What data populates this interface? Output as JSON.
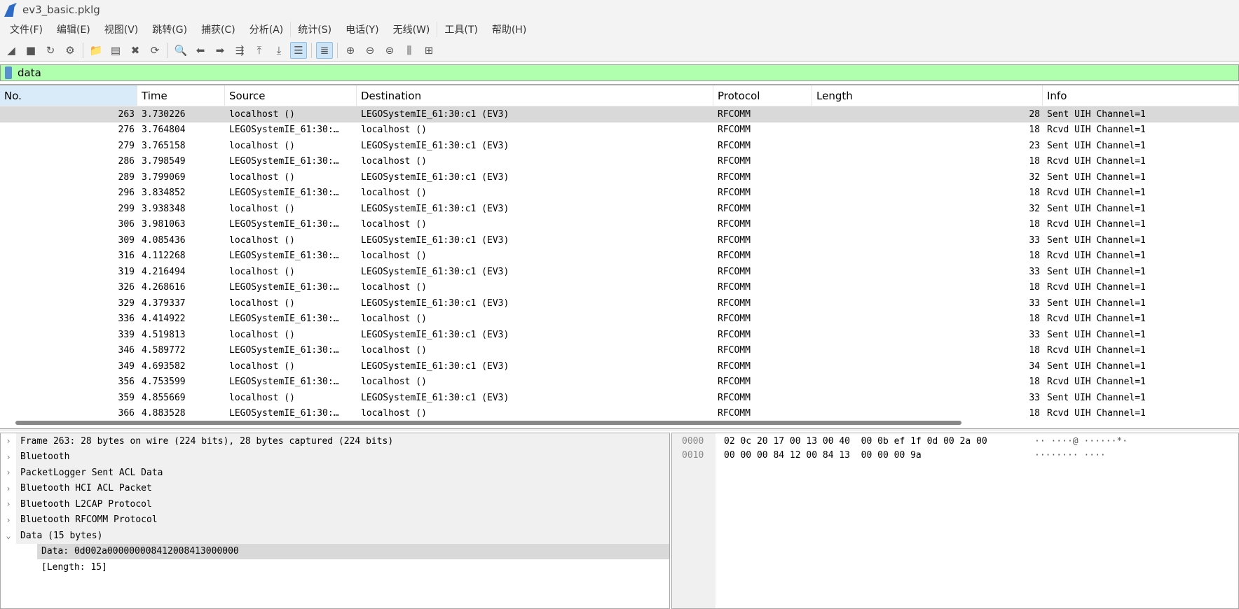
{
  "window": {
    "title": "ev3_basic.pklg"
  },
  "menu": [
    "文件(F)",
    "编辑(E)",
    "视图(V)",
    "跳转(G)",
    "捕获(C)",
    "分析(A)",
    "统计(S)",
    "电话(Y)",
    "无线(W)",
    "工具(T)",
    "帮助(H)"
  ],
  "toolbar": [
    {
      "icon": "shark-fin-start-icon",
      "glyph": "◢"
    },
    {
      "icon": "stop-icon",
      "glyph": "■"
    },
    {
      "icon": "restart-icon",
      "glyph": "↻"
    },
    {
      "icon": "capture-options-icon",
      "glyph": "⚙"
    },
    {
      "icon": "open-folder-icon",
      "glyph": "📁"
    },
    {
      "icon": "save-file-icon",
      "glyph": "▤"
    },
    {
      "icon": "close-file-icon",
      "glyph": "✖"
    },
    {
      "icon": "reload-icon",
      "glyph": "⟳"
    },
    {
      "icon": "find-icon",
      "glyph": "🔍"
    },
    {
      "icon": "go-back-icon",
      "glyph": "⬅"
    },
    {
      "icon": "go-forward-icon",
      "glyph": "➡"
    },
    {
      "icon": "go-to-packet-icon",
      "glyph": "⇶"
    },
    {
      "icon": "first-packet-icon",
      "glyph": "⤒"
    },
    {
      "icon": "last-packet-icon",
      "glyph": "⤓"
    },
    {
      "icon": "autoscroll-icon",
      "glyph": "☰"
    },
    {
      "icon": "colorize-icon",
      "glyph": "≣"
    },
    {
      "icon": "zoom-in-icon",
      "glyph": "⊕"
    },
    {
      "icon": "zoom-out-icon",
      "glyph": "⊖"
    },
    {
      "icon": "zoom-reset-icon",
      "glyph": "⊜"
    },
    {
      "icon": "resize-columns-icon",
      "glyph": "⫼"
    },
    {
      "icon": "layout-icon",
      "glyph": "⊞"
    }
  ],
  "filter": {
    "value": "data"
  },
  "columns": [
    "No.",
    "Time",
    "Source",
    "Destination",
    "Protocol",
    "Length",
    "Info"
  ],
  "packets": [
    [
      "263",
      "3.730226",
      "localhost ()",
      "LEGOSystemIE_61:30:c1 (EV3)",
      "RFCOMM",
      "28",
      "Sent UIH Channel=1"
    ],
    [
      "276",
      "3.764804",
      "LEGOSystemIE_61:30:…",
      "localhost ()",
      "RFCOMM",
      "18",
      "Rcvd UIH Channel=1"
    ],
    [
      "279",
      "3.765158",
      "localhost ()",
      "LEGOSystemIE_61:30:c1 (EV3)",
      "RFCOMM",
      "23",
      "Sent UIH Channel=1"
    ],
    [
      "286",
      "3.798549",
      "LEGOSystemIE_61:30:…",
      "localhost ()",
      "RFCOMM",
      "18",
      "Rcvd UIH Channel=1"
    ],
    [
      "289",
      "3.799069",
      "localhost ()",
      "LEGOSystemIE_61:30:c1 (EV3)",
      "RFCOMM",
      "32",
      "Sent UIH Channel=1"
    ],
    [
      "296",
      "3.834852",
      "LEGOSystemIE_61:30:…",
      "localhost ()",
      "RFCOMM",
      "18",
      "Rcvd UIH Channel=1"
    ],
    [
      "299",
      "3.938348",
      "localhost ()",
      "LEGOSystemIE_61:30:c1 (EV3)",
      "RFCOMM",
      "32",
      "Sent UIH Channel=1"
    ],
    [
      "306",
      "3.981063",
      "LEGOSystemIE_61:30:…",
      "localhost ()",
      "RFCOMM",
      "18",
      "Rcvd UIH Channel=1"
    ],
    [
      "309",
      "4.085436",
      "localhost ()",
      "LEGOSystemIE_61:30:c1 (EV3)",
      "RFCOMM",
      "33",
      "Sent UIH Channel=1"
    ],
    [
      "316",
      "4.112268",
      "LEGOSystemIE_61:30:…",
      "localhost ()",
      "RFCOMM",
      "18",
      "Rcvd UIH Channel=1"
    ],
    [
      "319",
      "4.216494",
      "localhost ()",
      "LEGOSystemIE_61:30:c1 (EV3)",
      "RFCOMM",
      "33",
      "Sent UIH Channel=1"
    ],
    [
      "326",
      "4.268616",
      "LEGOSystemIE_61:30:…",
      "localhost ()",
      "RFCOMM",
      "18",
      "Rcvd UIH Channel=1"
    ],
    [
      "329",
      "4.379337",
      "localhost ()",
      "LEGOSystemIE_61:30:c1 (EV3)",
      "RFCOMM",
      "33",
      "Sent UIH Channel=1"
    ],
    [
      "336",
      "4.414922",
      "LEGOSystemIE_61:30:…",
      "localhost ()",
      "RFCOMM",
      "18",
      "Rcvd UIH Channel=1"
    ],
    [
      "339",
      "4.519813",
      "localhost ()",
      "LEGOSystemIE_61:30:c1 (EV3)",
      "RFCOMM",
      "33",
      "Sent UIH Channel=1"
    ],
    [
      "346",
      "4.589772",
      "LEGOSystemIE_61:30:…",
      "localhost ()",
      "RFCOMM",
      "18",
      "Rcvd UIH Channel=1"
    ],
    [
      "349",
      "4.693582",
      "localhost ()",
      "LEGOSystemIE_61:30:c1 (EV3)",
      "RFCOMM",
      "34",
      "Sent UIH Channel=1"
    ],
    [
      "356",
      "4.753599",
      "LEGOSystemIE_61:30:…",
      "localhost ()",
      "RFCOMM",
      "18",
      "Rcvd UIH Channel=1"
    ],
    [
      "359",
      "4.855669",
      "localhost ()",
      "LEGOSystemIE_61:30:c1 (EV3)",
      "RFCOMM",
      "33",
      "Sent UIH Channel=1"
    ],
    [
      "366",
      "4.883528",
      "LEGOSystemIE_61:30:…",
      "localhost ()",
      "RFCOMM",
      "18",
      "Rcvd UIH Channel=1"
    ]
  ],
  "details": [
    {
      "label": "Frame 263: 28 bytes on wire (224 bits), 28 bytes captured (224 bits)",
      "expanded": false
    },
    {
      "label": "Bluetooth",
      "expanded": false
    },
    {
      "label": "PacketLogger Sent ACL Data",
      "expanded": false
    },
    {
      "label": "Bluetooth HCI ACL Packet",
      "expanded": false
    },
    {
      "label": "Bluetooth L2CAP Protocol",
      "expanded": false
    },
    {
      "label": "Bluetooth RFCOMM Protocol",
      "expanded": false
    },
    {
      "label": "Data (15 bytes)",
      "expanded": true,
      "children": [
        "Data: 0d002a000000008412008413000000",
        "[Length: 15]"
      ]
    }
  ],
  "hex": {
    "offsets": [
      "0000",
      "0010"
    ],
    "bytes": [
      "02 0c 20 17 00 13 00 40  00 0b ef 1f 0d 00 2a 00",
      "00 00 00 84 12 00 84 13  00 00 00 9a"
    ],
    "ascii": [
      "·· ····@ ······*·",
      "········ ····"
    ]
  }
}
